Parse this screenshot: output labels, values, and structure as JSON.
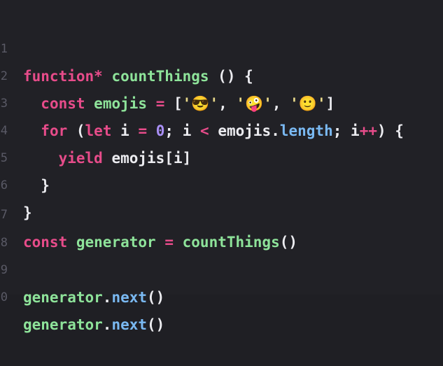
{
  "line_numbers": [
    "1",
    "2",
    "3",
    "4",
    "5",
    "6",
    "7",
    "8",
    "9",
    "0"
  ],
  "lines": {
    "l1": {
      "kw": "function*",
      "name": "countThings",
      "rest": " () {"
    },
    "l2": {
      "kw": "const",
      "name": "emojis",
      "eq": "=",
      "open": "[",
      "s1": "'😎'",
      "c1": ",",
      "s2": "'🤪'",
      "c2": ",",
      "s3": "'🙂'",
      "close": "]"
    },
    "l3": {
      "kw": "for",
      "p1": " (",
      "kw2": "let",
      "i": "i",
      "eq": "=",
      "zero": "0",
      "semi1": ";",
      "i2": "i",
      "lt": "<",
      "obj": "emojis",
      "dot": ".",
      "prop": "length",
      "semi2": ";",
      "i3": "i",
      "inc": "++",
      "end": ") {"
    },
    "l4": {
      "kw": "yield",
      "expr": "emojis[i]"
    },
    "l5": {
      "brace": "}"
    },
    "l6": {
      "brace": "}"
    },
    "l7": {
      "kw": "const",
      "name": "generator",
      "eq": "=",
      "call": "countThings",
      "paren": "()"
    },
    "l8": {},
    "l9": {
      "obj": "generator",
      "dot": ".",
      "method": "next",
      "paren": "()"
    },
    "l10": {
      "obj": "generator",
      "dot": ".",
      "method": "next",
      "paren": "()"
    }
  }
}
